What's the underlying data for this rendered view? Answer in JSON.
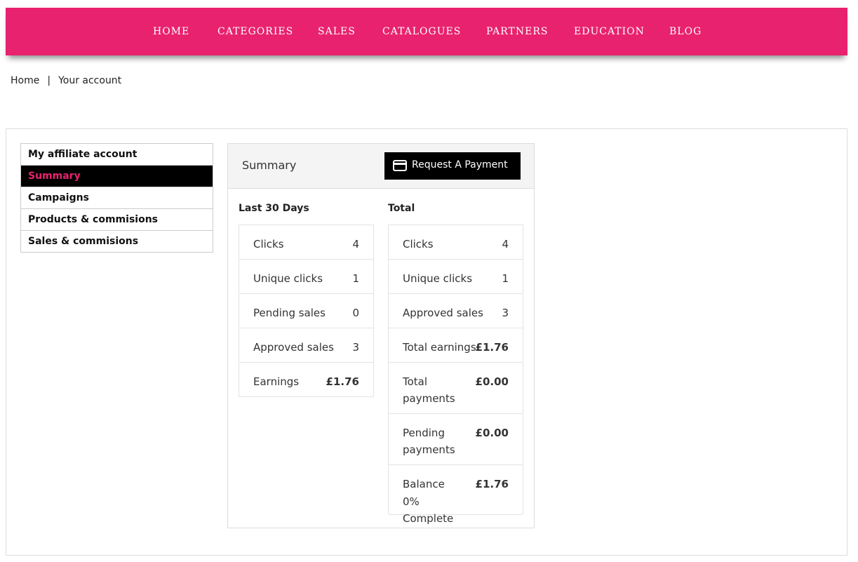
{
  "nav": {
    "items": [
      "HOME",
      "CATEGORIES",
      "SALES",
      "CATALOGUES",
      "PARTNERS",
      "EDUCATION",
      "BLOG"
    ]
  },
  "breadcrumb": {
    "home": "Home",
    "separator": "|",
    "current": "Your account"
  },
  "sidebar": {
    "items": [
      {
        "label": "My affiliate account"
      },
      {
        "label": "Summary"
      },
      {
        "label": "Campaigns"
      },
      {
        "label": "Products & commisions"
      },
      {
        "label": "Sales & commisions"
      }
    ]
  },
  "summary": {
    "title": "Summary",
    "request_payment_label": "Request A Payment",
    "last30": {
      "title": "Last 30 Days",
      "rows": [
        {
          "label": "Clicks",
          "value": "4"
        },
        {
          "label": "Unique clicks",
          "value": "1"
        },
        {
          "label": "Pending sales",
          "value": "0"
        },
        {
          "label": "Approved sales",
          "value": "3"
        },
        {
          "label": "Earnings",
          "value": "£1.76"
        }
      ]
    },
    "total": {
      "title": "Total",
      "rows": [
        {
          "label": "Clicks",
          "value": "4"
        },
        {
          "label": "Unique clicks",
          "value": "1"
        },
        {
          "label": "Approved sales",
          "value": "3"
        },
        {
          "label": "Total earnings",
          "value": "£1.76"
        },
        {
          "label": "Total payments",
          "value": "£0.00"
        },
        {
          "label": "Pending payments",
          "value": "£0.00"
        },
        {
          "label": "Balance",
          "value": "£1.76"
        }
      ],
      "balance_progress": "0% Complete"
    }
  },
  "colors": {
    "brand": "#e8226f",
    "active_bg": "#000000"
  }
}
